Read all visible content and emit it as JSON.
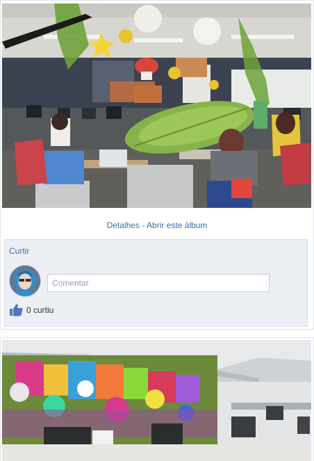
{
  "posts": [
    {
      "links": {
        "details_label": "Detalhes",
        "separator": "-",
        "open_album_label": "Abrir este álbum"
      },
      "social": {
        "like_label": "Curtir",
        "comment_placeholder": "Comentar",
        "likes_count_label": "0 curtiu"
      }
    }
  ],
  "icons": {
    "like": "thumbs-up-icon",
    "avatar": "user-avatar"
  },
  "colors": {
    "link": "#3b6fa8",
    "panel_background": "#eceff4",
    "like_icon": "#4f79b8"
  }
}
